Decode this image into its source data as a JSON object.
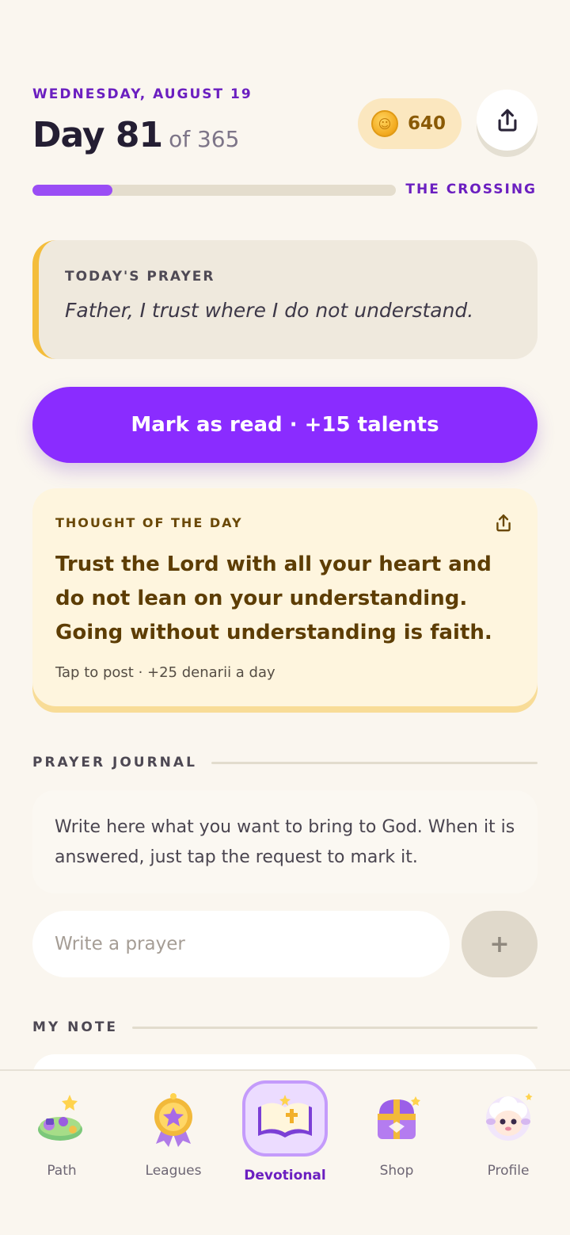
{
  "header": {
    "date": "WEDNESDAY, AUGUST 19",
    "day_number": "Day 81",
    "day_total": "of 365",
    "coins": "640",
    "stage": "THE CROSSING",
    "progress": 0.22
  },
  "prayer": {
    "label": "TODAY'S PRAYER",
    "text": "Father, I trust where I do not understand."
  },
  "mark_read": {
    "label": "Mark as read · +15 talents"
  },
  "thought": {
    "label": "THOUGHT OF THE DAY",
    "text": "Trust the Lord with all your heart and do not lean on your understanding. Going without understanding is faith.",
    "footer": "Tap to post · +25 denarii a day"
  },
  "journal": {
    "heading": "PRAYER JOURNAL",
    "info": "Write here what you want to bring to God. When it is answered, just tap the request to mark it.",
    "input_placeholder": "Write a prayer",
    "add_label": "+"
  },
  "note": {
    "heading": "MY NOTE"
  },
  "tabs": [
    {
      "label": "Path",
      "icon": "path-icon"
    },
    {
      "label": "Leagues",
      "icon": "leagues-medal-icon"
    },
    {
      "label": "Devotional",
      "icon": "devotional-book-icon",
      "active": true
    },
    {
      "label": "Shop",
      "icon": "shop-chest-icon"
    },
    {
      "label": "Profile",
      "icon": "profile-lamb-icon"
    }
  ],
  "colors": {
    "accent": "#8a2cff",
    "accent_text": "#6b1fc0",
    "background": "#faf6ef",
    "gold": "#f4bd3b"
  }
}
